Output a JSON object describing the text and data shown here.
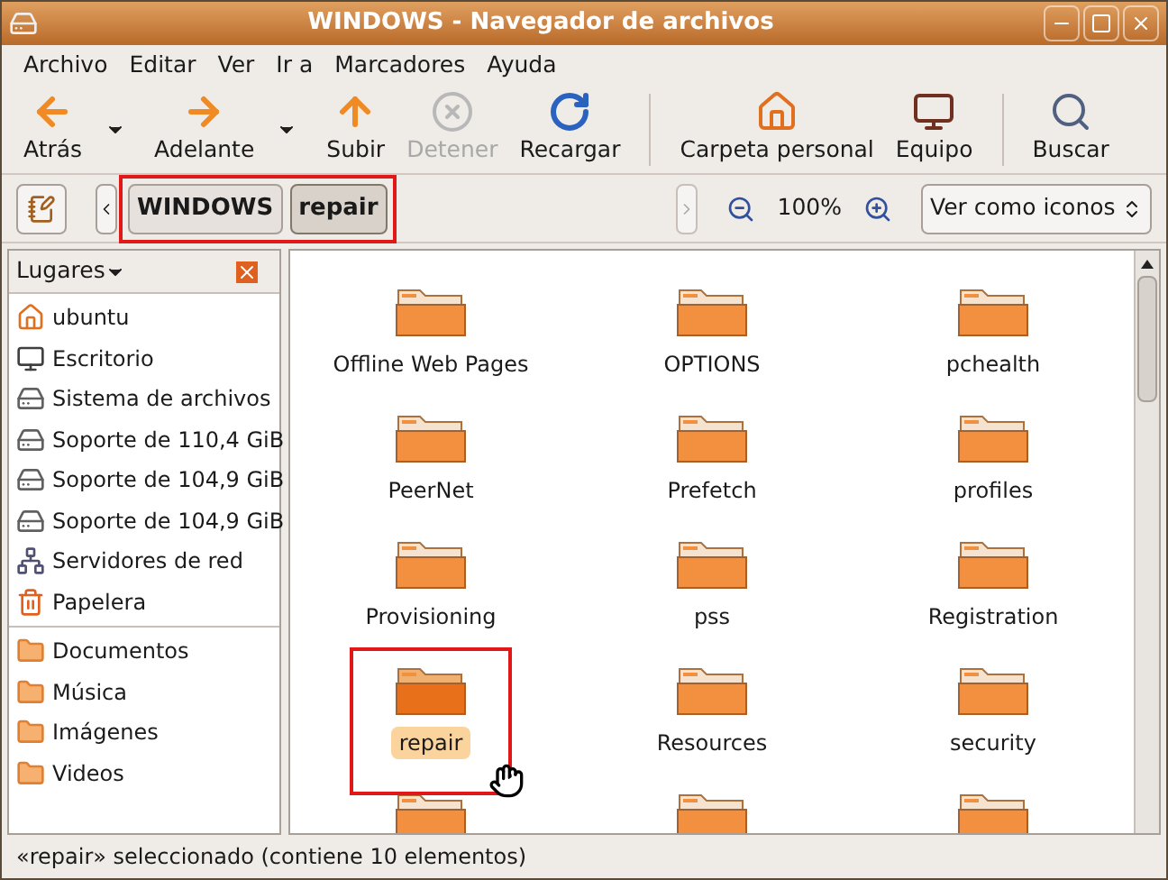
{
  "window": {
    "title": "WINDOWS - Navegador de archivos"
  },
  "menu": [
    "Archivo",
    "Editar",
    "Ver",
    "Ir a",
    "Marcadores",
    "Ayuda"
  ],
  "toolbar": [
    {
      "kind": "back",
      "label": "Atrás",
      "disabled": false,
      "dropdown": true
    },
    {
      "kind": "forward",
      "label": "Adelante",
      "disabled": false,
      "dropdown": true
    },
    {
      "kind": "up",
      "label": "Subir",
      "disabled": false,
      "dropdown": false
    },
    {
      "kind": "stop",
      "label": "Detener",
      "disabled": true,
      "dropdown": false
    },
    {
      "kind": "reload",
      "label": "Recargar",
      "disabled": false,
      "dropdown": false
    },
    {
      "kind": "separator"
    },
    {
      "kind": "home",
      "label": "Carpeta personal",
      "disabled": false,
      "dropdown": false
    },
    {
      "kind": "computer",
      "label": "Equipo",
      "disabled": false,
      "dropdown": false
    },
    {
      "kind": "separator"
    },
    {
      "kind": "search",
      "label": "Buscar",
      "disabled": false,
      "dropdown": false
    }
  ],
  "location": {
    "breadcrumbs": [
      {
        "label": "WINDOWS",
        "selected": false
      },
      {
        "label": "repair",
        "selected": true
      }
    ],
    "zoom": "100%",
    "view": "Ver como iconos"
  },
  "sidebar": {
    "title": "Lugares",
    "sections": [
      [
        {
          "kind": "home",
          "label": "ubuntu"
        },
        {
          "kind": "desktop",
          "label": "Escritorio"
        },
        {
          "kind": "drive",
          "label": "Sistema de archivos"
        },
        {
          "kind": "drive",
          "label": "Soporte de 110,4 GiB"
        },
        {
          "kind": "drive",
          "label": "Soporte de 104,9 GiB"
        },
        {
          "kind": "drive",
          "label": "Soporte de 104,9 GiB"
        },
        {
          "kind": "network",
          "label": "Servidores de red"
        },
        {
          "kind": "trash",
          "label": "Papelera"
        }
      ],
      [
        {
          "kind": "folder",
          "label": "Documentos"
        },
        {
          "kind": "folder",
          "label": "Música"
        },
        {
          "kind": "folder",
          "label": "Imágenes"
        },
        {
          "kind": "folder",
          "label": "Videos"
        }
      ]
    ]
  },
  "files": [
    {
      "name": "Offline Web Pages",
      "selected": false
    },
    {
      "name": "OPTIONS",
      "selected": false
    },
    {
      "name": "pchealth",
      "selected": false
    },
    {
      "name": "PeerNet",
      "selected": false
    },
    {
      "name": "Prefetch",
      "selected": false
    },
    {
      "name": "profiles",
      "selected": false
    },
    {
      "name": "Provisioning",
      "selected": false
    },
    {
      "name": "pss",
      "selected": false
    },
    {
      "name": "Registration",
      "selected": false
    },
    {
      "name": "repair",
      "selected": true
    },
    {
      "name": "Resources",
      "selected": false
    },
    {
      "name": "security",
      "selected": false
    }
  ],
  "status_bar": "«repair» seleccionado (contiene 10 elementos)"
}
